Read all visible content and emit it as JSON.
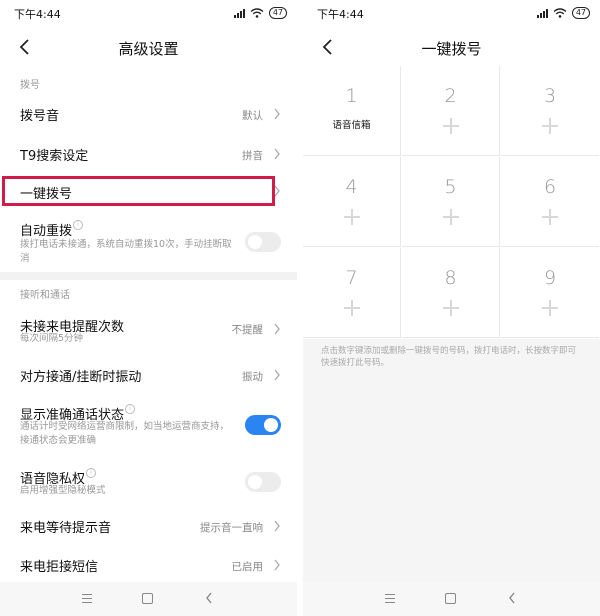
{
  "left": {
    "status": {
      "time": "下午4:44",
      "battery": "47"
    },
    "title": "高级设置",
    "section1": "拨号",
    "rows1": [
      {
        "label": "拨号音",
        "value": "默认"
      },
      {
        "label": "T9搜索设定",
        "value": "拼音"
      },
      {
        "label": "一键拨号",
        "value": ""
      }
    ],
    "auto_redial": {
      "label": "自动重拨",
      "desc": "拨打电话未接通，系统自动重拨10次，手动挂断取消",
      "on": false
    },
    "section2": "接听和通话",
    "missed": {
      "label": "未接来电提醒次数",
      "desc": "每次间隔5分钟",
      "value": "不提醒"
    },
    "vibrate": {
      "label": "对方接通/挂断时振动",
      "value": "振动"
    },
    "accurate": {
      "label": "显示准确通话状态",
      "desc": "通话计时受网络运营商限制，如当地运营商支持，接通状态会更准确",
      "on": true
    },
    "privacy": {
      "label": "语音隐私权",
      "desc": "启用增强型隐秘模式",
      "on": false
    },
    "waiting": {
      "label": "来电等待提示音",
      "value": "提示音一直响"
    },
    "reject_sms": {
      "label": "来电拒接短信",
      "value": "已启用"
    }
  },
  "right": {
    "status": {
      "time": "下午4:44",
      "battery": "47"
    },
    "title": "一键拨号",
    "keys": [
      {
        "num": "1",
        "name": "语音信箱"
      },
      {
        "num": "2",
        "name": ""
      },
      {
        "num": "3",
        "name": ""
      },
      {
        "num": "4",
        "name": ""
      },
      {
        "num": "5",
        "name": ""
      },
      {
        "num": "6",
        "name": ""
      },
      {
        "num": "7",
        "name": ""
      },
      {
        "num": "8",
        "name": ""
      },
      {
        "num": "9",
        "name": ""
      }
    ],
    "hint": "点击数字键添加或删除一键拨号的号码，拨打电话时，长按数字即可快速拨打此号码。"
  },
  "colors": {
    "accent": "#2a84f1",
    "highlight": "#d01c48"
  }
}
